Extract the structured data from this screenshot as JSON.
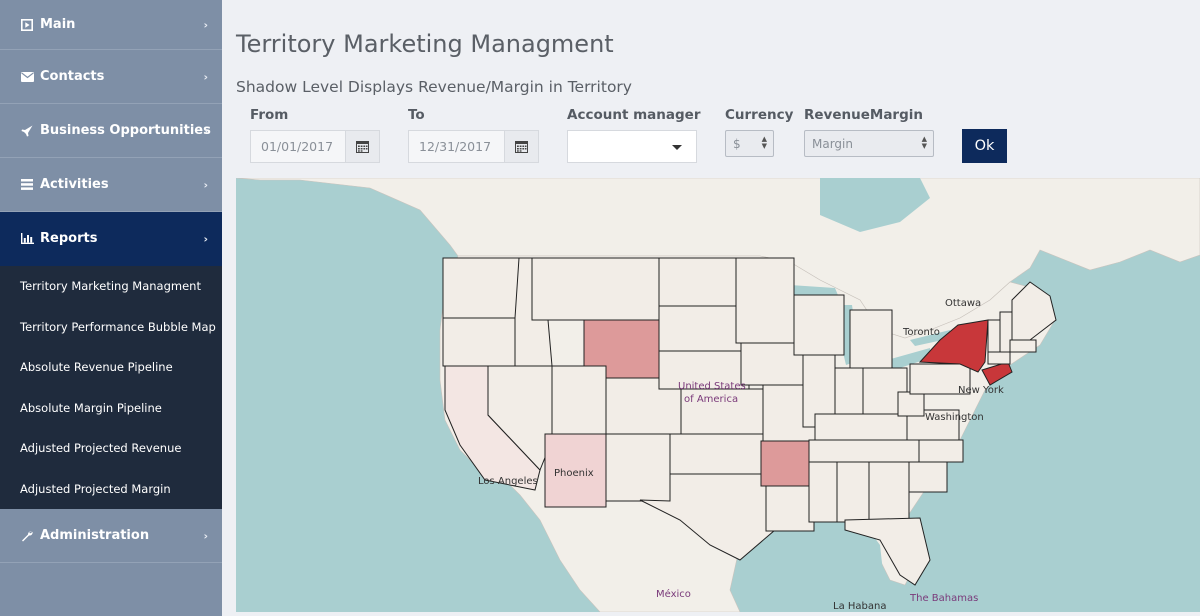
{
  "sidebar": {
    "items": [
      {
        "label": "Main",
        "icon": "play-square-icon"
      },
      {
        "label": "Contacts",
        "icon": "envelope-icon"
      },
      {
        "label": "Business Opportunities",
        "icon": "rocket-icon"
      },
      {
        "label": "Activities",
        "icon": "list-icon"
      },
      {
        "label": "Reports",
        "icon": "bar-chart-icon"
      }
    ],
    "reports_submenu": [
      "Territory Marketing Managment",
      "Territory Performance Bubble Map",
      "Absolute Revenue Pipeline",
      "Absolute Margin Pipeline",
      "Adjusted Projected Revenue",
      "Adjusted Projected Margin"
    ],
    "administration": {
      "label": "Administration",
      "icon": "wrench-icon"
    },
    "chevron": "›"
  },
  "header": {
    "title": "Territory Marketing Managment",
    "subtitle": "Shadow Level Displays Revenue/Margin in Territory"
  },
  "filters": {
    "from_label": "From",
    "from_value": "01/01/2017",
    "to_label": "To",
    "to_value": "12/31/2017",
    "account_manager_label": "Account manager",
    "account_manager_value": "",
    "currency_label": "Currency",
    "currency_value": "$",
    "revenue_margin_label": "RevenueMargin",
    "revenue_margin_value": "Margin",
    "ok_label": "Ok"
  },
  "map": {
    "labels": {
      "ottawa": "Ottawa",
      "toronto": "Toronto",
      "us_line1": "United States",
      "us_line2": "of America",
      "new_york": "New York",
      "washington": "Washington",
      "phoenix": "Phoenix",
      "los_angeles": "Los Angeles",
      "mexico": "México",
      "la_habana": "La Habana",
      "bahamas": "The Bahamas"
    },
    "colors": {
      "water": "#a9cfd0",
      "land": "#f2efe9",
      "state": "#f2ede7",
      "high": "#c8373a",
      "medium": "#dd9a9a",
      "low": "#f0dada",
      "light": "#f3e6e3"
    }
  }
}
